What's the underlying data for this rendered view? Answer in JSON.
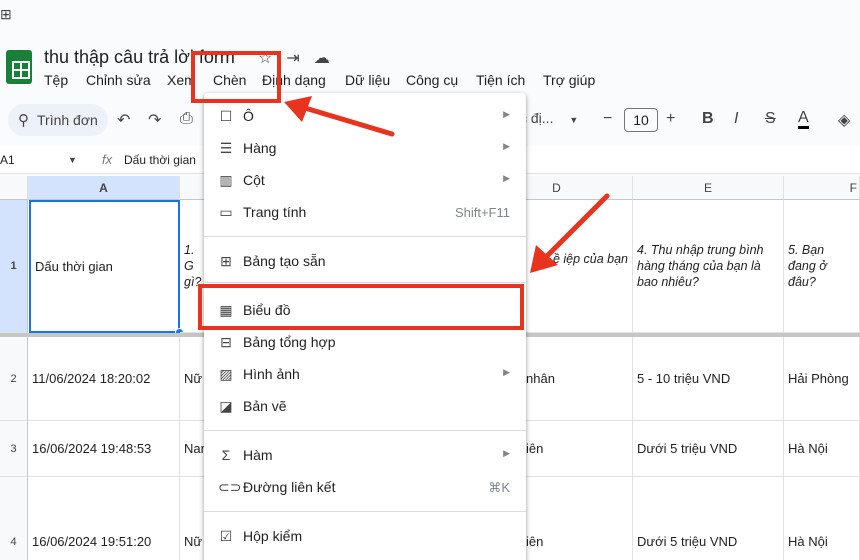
{
  "header": {
    "doc_title": "thu thập câu trả lời form",
    "menus": [
      "Tệp",
      "Chỉnh sửa",
      "Xem",
      "Chèn",
      "Định dạng",
      "Dữ liệu",
      "Công cụ",
      "Tiện ích",
      "Trợ giúp"
    ]
  },
  "toolbar": {
    "search_label": "Trình đơn",
    "font_name": "c đị...",
    "font_size": "10"
  },
  "formula_bar": {
    "cell_ref": "A1",
    "fx": "fx",
    "value": "Dấu thời gian"
  },
  "grid": {
    "columns": [
      "A",
      "D",
      "E",
      "F"
    ],
    "rows": [
      {
        "num": "1",
        "a": "Dấu thời gian",
        "b": "1. G\ngì?",
        "d": "ề  iệp của bạn",
        "e": "4. Thu nhập trung bình hàng tháng của bạn là bao nhiêu?",
        "f": "5.  Bạn đang ở đâu?"
      },
      {
        "num": "2",
        "a": "11/06/2024 18:20:02",
        "b": "Nữ",
        "d": "nhân",
        "e": "5 - 10 triệu VND",
        "f": "Hải Phòng"
      },
      {
        "num": "3",
        "a": "16/06/2024 19:48:53",
        "b": "Nam",
        "d": "iên",
        "e": "Dưới 5 triệu VND",
        "f": "Hà Nội"
      },
      {
        "num": "4",
        "a": "16/06/2024 19:51:20",
        "b": "Nữ",
        "d": "iên",
        "e": "Dưới 5 triệu VND",
        "f": "Hà Nội"
      }
    ]
  },
  "insert_menu": {
    "items": [
      {
        "label": "Ô",
        "icon": "cell-icon",
        "submenu": true
      },
      {
        "label": "Hàng",
        "icon": "rows-icon",
        "submenu": true
      },
      {
        "label": "Cột",
        "icon": "columns-icon",
        "submenu": true
      },
      {
        "label": "Trang tính",
        "icon": "sheet-icon",
        "shortcut": "Shift+F11"
      },
      {
        "label": "Bảng tạo sẵn",
        "icon": "table-icon"
      },
      {
        "label": "Biểu đồ",
        "icon": "chart-icon"
      },
      {
        "label": "Bảng tổng hợp",
        "icon": "pivot-icon"
      },
      {
        "label": "Hình ảnh",
        "icon": "image-icon",
        "submenu": true
      },
      {
        "label": "Bản vẽ",
        "icon": "drawing-icon"
      },
      {
        "label": "Hàm",
        "icon": "sigma-icon",
        "submenu": true
      },
      {
        "label": "Đường liên kết",
        "icon": "link-icon",
        "shortcut": "⌘K"
      },
      {
        "label": "Hộp kiểm",
        "icon": "checkbox-icon"
      }
    ]
  },
  "colors": {
    "annotation_red": "#e8331e",
    "sheets_green": "#188038",
    "selection_blue": "#1a73e8"
  }
}
